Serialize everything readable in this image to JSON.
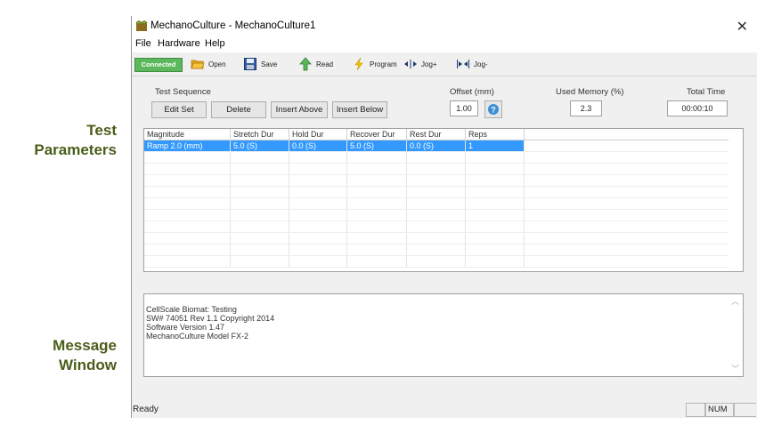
{
  "callouts": {
    "test_parameters": [
      "Test",
      "Parameters"
    ],
    "message_window": [
      "Message",
      "Window"
    ]
  },
  "window": {
    "title": "MechanoCulture - MechanoCulture1",
    "close": "✕"
  },
  "menu": [
    "File",
    "Hardware",
    "Help"
  ],
  "toolbar": {
    "status": "Connected",
    "open": "Open",
    "save": "Save",
    "read": "Read",
    "program": "Program",
    "jog_plus": "Jog+",
    "jog_minus": "Jog-"
  },
  "sequence": {
    "label": "Test Sequence",
    "edit_set": "Edit Set",
    "delete": "Delete",
    "insert_above": "Insert Above",
    "insert_below": "Insert Below"
  },
  "offset": {
    "label": "Offset (mm)",
    "value": "1.00"
  },
  "memory": {
    "label": "Used Memory (%)",
    "value": "2.3"
  },
  "total_time": {
    "label": "Total Time",
    "value": "00:00:10"
  },
  "grid": {
    "columns": [
      "Magnitude",
      "Stretch Dur",
      "Hold Dur",
      "Recover Dur",
      "Rest Dur",
      "Reps"
    ],
    "rows": [
      [
        "Ramp 2.0 (mm)",
        "5.0 (S)",
        "0.0 (S)",
        "5.0 (S)",
        "0.0 (S)",
        "1"
      ]
    ]
  },
  "messages": [
    "CellScale Biomat: Testing",
    "SW# 74051  Rev 1.1   Copyright 2014",
    "Software Version 1.47",
    "MechanoCulture Model FX-2"
  ],
  "status": {
    "text": "Ready",
    "num": "NUM"
  },
  "colors": {
    "accent_green": "#5cb85c",
    "selection": "#3399ff",
    "callout": "#4a5e1a"
  }
}
